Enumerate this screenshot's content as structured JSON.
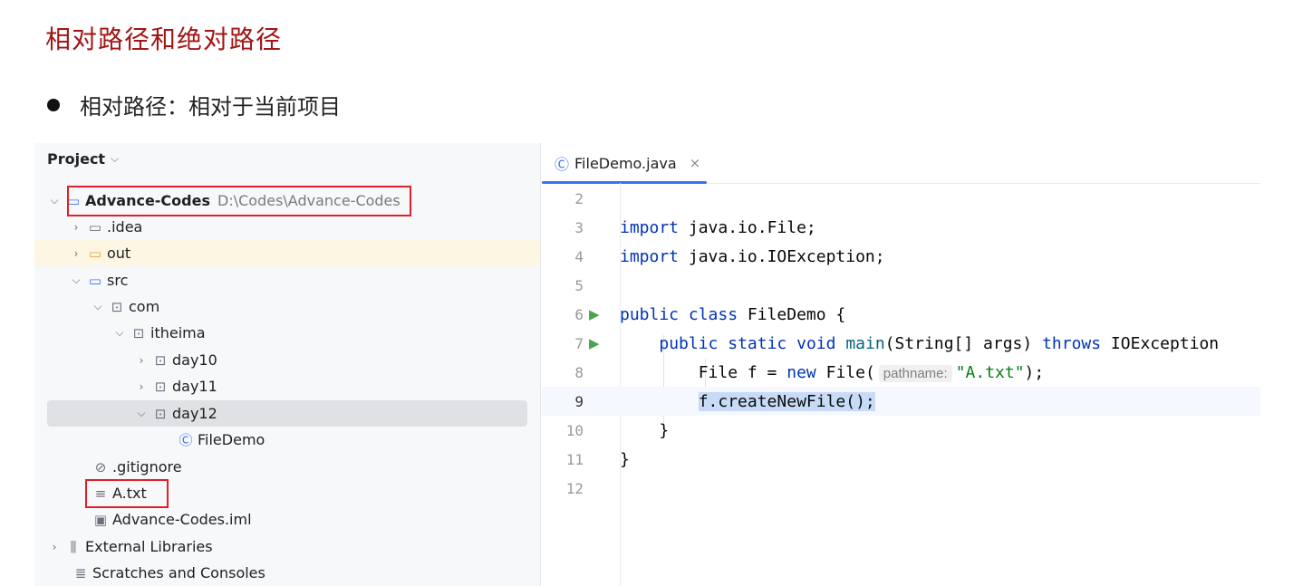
{
  "doc": {
    "title": "相对路径和绝对路径",
    "bullet": "相对路径：相对于当前项目"
  },
  "project_panel": {
    "header": "Project",
    "tree": {
      "root": {
        "name": "Advance-Codes",
        "path": "D:\\Codes\\Advance-Codes"
      },
      "idea": ".idea",
      "out": "out",
      "src": "src",
      "com": "com",
      "itheima": "itheima",
      "day10": "day10",
      "day11": "day11",
      "day12": "day12",
      "filedemo": "FileDemo",
      "gitignore": ".gitignore",
      "atxt": "A.txt",
      "iml": "Advance-Codes.iml",
      "external": "External Libraries",
      "scratches": "Scratches and Consoles"
    }
  },
  "editor": {
    "tab": "FileDemo.java",
    "lines": {
      "l2": "2",
      "l3": "3",
      "l4": "4",
      "l5": "5",
      "l6": "6",
      "l7": "7",
      "l8": "8",
      "l9": "9",
      "l10": "10",
      "l11": "11",
      "l12": "12"
    },
    "code": {
      "import_kw": "import",
      "import_file": " java.io.File;",
      "import_ioe": " java.io.IOException;",
      "public_kw": "public",
      "class_kw": "class",
      "class_name": " FileDemo {",
      "static_kw": "static",
      "void_kw": "void",
      "main_fn": "main",
      "main_args": "(String[] args) ",
      "throws_kw": "throws",
      "throws_type": " IOException",
      "file_decl": "File f = ",
      "new_kw": "new",
      "file_ctor": " File(",
      "param_hint": "pathname:",
      "string_arg": "\"A.txt\"",
      "ctor_close": ");",
      "create_call": "f.createNewFile();",
      "close_method": "}",
      "close_class": "}"
    }
  },
  "colors": {
    "title_red": "#a31515",
    "keyword_blue": "#0033b3",
    "string_green": "#067d17",
    "highlight_red_box": "#e0202a",
    "tab_accent": "#3574f0"
  }
}
